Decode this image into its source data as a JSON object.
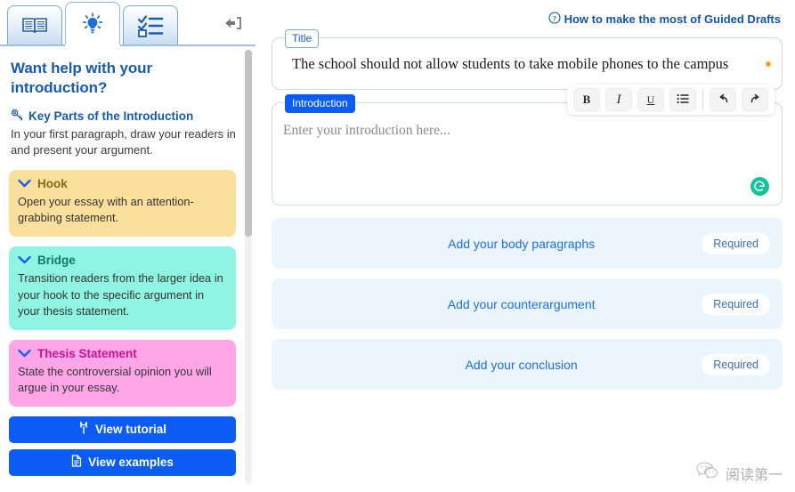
{
  "tabs": [
    {
      "id": "reading",
      "icon": "open-book-icon",
      "active": false
    },
    {
      "id": "ideas",
      "icon": "lightbulb-icon",
      "active": true
    },
    {
      "id": "checklist",
      "icon": "checklist-icon",
      "active": false
    }
  ],
  "collapse_button": {
    "icon": "collapse-panel-left-icon"
  },
  "sidebar": {
    "title": "Want help with your introduction?",
    "subtitle": "Key Parts of the Introduction",
    "subtitle_icon": "key-icon",
    "description": "In your first paragraph, draw your readers in and present your argument.",
    "parts": [
      {
        "name": "Hook",
        "body": "Open your essay with an attention-grabbing statement.",
        "bg": "#fbdf9d",
        "title_color": "#8a6a12",
        "chevron_icon": "chevron-down-icon"
      },
      {
        "name": "Bridge",
        "body": "Transition readers from the larger idea in your hook to the specific argument in your thesis statement.",
        "bg": "#8ff5e2",
        "title_color": "#12776a",
        "chevron_icon": "chevron-down-icon"
      },
      {
        "name": "Thesis Statement",
        "body": "State the controversial opinion you will argue in your essay.",
        "bg": "#ffa6e8",
        "title_color": "#c4158f",
        "chevron_icon": "chevron-down-icon"
      }
    ],
    "buttons": [
      {
        "label": "View tutorial",
        "icon": "tutorial-icon"
      },
      {
        "label": "View examples",
        "icon": "document-icon"
      }
    ]
  },
  "header": {
    "help_link": "How to make the most of Guided Drafts",
    "help_icon": "question-circle-icon"
  },
  "editor": {
    "title_field": {
      "label": "Title",
      "value": "The school should not allow students to take mobile phones to the campus",
      "status_dot_color": "#f5a623"
    },
    "intro_field": {
      "label": "Introduction",
      "placeholder": "Enter your introduction here...",
      "value": "",
      "assistant_icon": "grammarly-icon",
      "assistant_color": "#15c39a"
    },
    "toolbar": [
      {
        "id": "bold",
        "glyph": "B",
        "icon": "bold-icon"
      },
      {
        "id": "italic",
        "glyph": "I",
        "icon": "italic-icon"
      },
      {
        "id": "underline",
        "glyph": "U",
        "icon": "underline-icon"
      },
      {
        "id": "list",
        "glyph": "☰",
        "icon": "bulleted-list-icon"
      },
      {
        "id": "separator",
        "glyph": "",
        "icon": "toolbar-separator"
      },
      {
        "id": "undo",
        "glyph": "↶",
        "icon": "undo-icon"
      },
      {
        "id": "redo",
        "glyph": "↷",
        "icon": "redo-icon"
      }
    ],
    "sections": [
      {
        "label": "Add your body paragraphs",
        "badge": "Required"
      },
      {
        "label": "Add your counterargument",
        "badge": "Required"
      },
      {
        "label": "Add your conclusion",
        "badge": "Required"
      }
    ]
  },
  "watermark": {
    "text": "阅读第一",
    "icon": "wechat-icon"
  },
  "colors": {
    "accent_blue": "#0a5cf5",
    "link_blue": "#1f6fe0",
    "heading_blue": "#1a5aa8",
    "card_bg": "#eaf5fd"
  }
}
